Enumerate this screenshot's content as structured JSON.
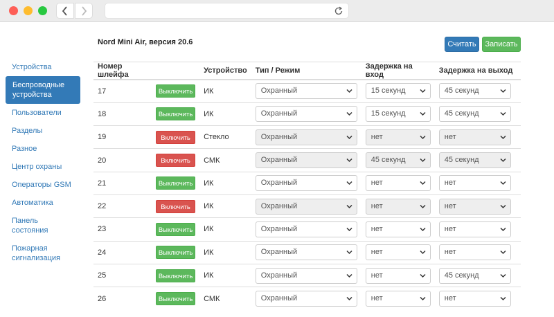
{
  "app": {
    "title": "Nord Mini Air, версия 20.6"
  },
  "toolbar": {
    "read_label": "Считать",
    "write_label": "Записать"
  },
  "sidebar": {
    "items": [
      {
        "label": "Устройства",
        "active": false
      },
      {
        "label": "Беспроводные устройства",
        "active": true
      },
      {
        "label": "Пользователи",
        "active": false
      },
      {
        "label": "Разделы",
        "active": false
      },
      {
        "label": "Разное",
        "active": false
      },
      {
        "label": "Центр охраны",
        "active": false
      },
      {
        "label": "Операторы GSM",
        "active": false
      },
      {
        "label": "Автоматика",
        "active": false
      },
      {
        "label": "Панель состояния",
        "active": false
      },
      {
        "label": "Пожарная сигнализация",
        "active": false
      }
    ]
  },
  "table": {
    "headers": [
      "Номер шлейфа",
      "",
      "Устройство",
      "Тип / Режим",
      "Задержка на вход",
      "Задержка на выход"
    ],
    "rows": [
      {
        "num": "17",
        "button": "Выключить",
        "enabled": true,
        "device": "ИК",
        "mode": "Охранный",
        "delay_in": "15 секунд",
        "delay_out": "45 секунд"
      },
      {
        "num": "18",
        "button": "Выключить",
        "enabled": true,
        "device": "ИК",
        "mode": "Охранный",
        "delay_in": "15 секунд",
        "delay_out": "45 секунд"
      },
      {
        "num": "19",
        "button": "Включить",
        "enabled": false,
        "device": "Стекло",
        "mode": "Охранный",
        "delay_in": "нет",
        "delay_out": "нет"
      },
      {
        "num": "20",
        "button": "Включить",
        "enabled": false,
        "device": "СМК",
        "mode": "Охранный",
        "delay_in": "45 секунд",
        "delay_out": "45 секунд"
      },
      {
        "num": "21",
        "button": "Выключить",
        "enabled": true,
        "device": "ИК",
        "mode": "Охранный",
        "delay_in": "нет",
        "delay_out": "нет"
      },
      {
        "num": "22",
        "button": "Включить",
        "enabled": false,
        "device": "ИК",
        "mode": "Охранный",
        "delay_in": "нет",
        "delay_out": "нет"
      },
      {
        "num": "23",
        "button": "Выключить",
        "enabled": true,
        "device": "ИК",
        "mode": "Охранный",
        "delay_in": "нет",
        "delay_out": "нет"
      },
      {
        "num": "24",
        "button": "Выключить",
        "enabled": true,
        "device": "ИК",
        "mode": "Охранный",
        "delay_in": "нет",
        "delay_out": "нет"
      },
      {
        "num": "25",
        "button": "Выключить",
        "enabled": true,
        "device": "ИК",
        "mode": "Охранный",
        "delay_in": "нет",
        "delay_out": "45 секунд"
      },
      {
        "num": "26",
        "button": "Выключить",
        "enabled": true,
        "device": "СМК",
        "mode": "Охранный",
        "delay_in": "нет",
        "delay_out": "нет"
      }
    ]
  },
  "colors": {
    "primary": "#337ab7",
    "success": "#5cb85c",
    "danger": "#d9534f",
    "disabled_bg": "#eeeeee"
  },
  "icons": {
    "back": "chevron-left-icon",
    "forward": "chevron-right-icon",
    "reload": "reload-icon",
    "select": "chevron-down-icon"
  }
}
